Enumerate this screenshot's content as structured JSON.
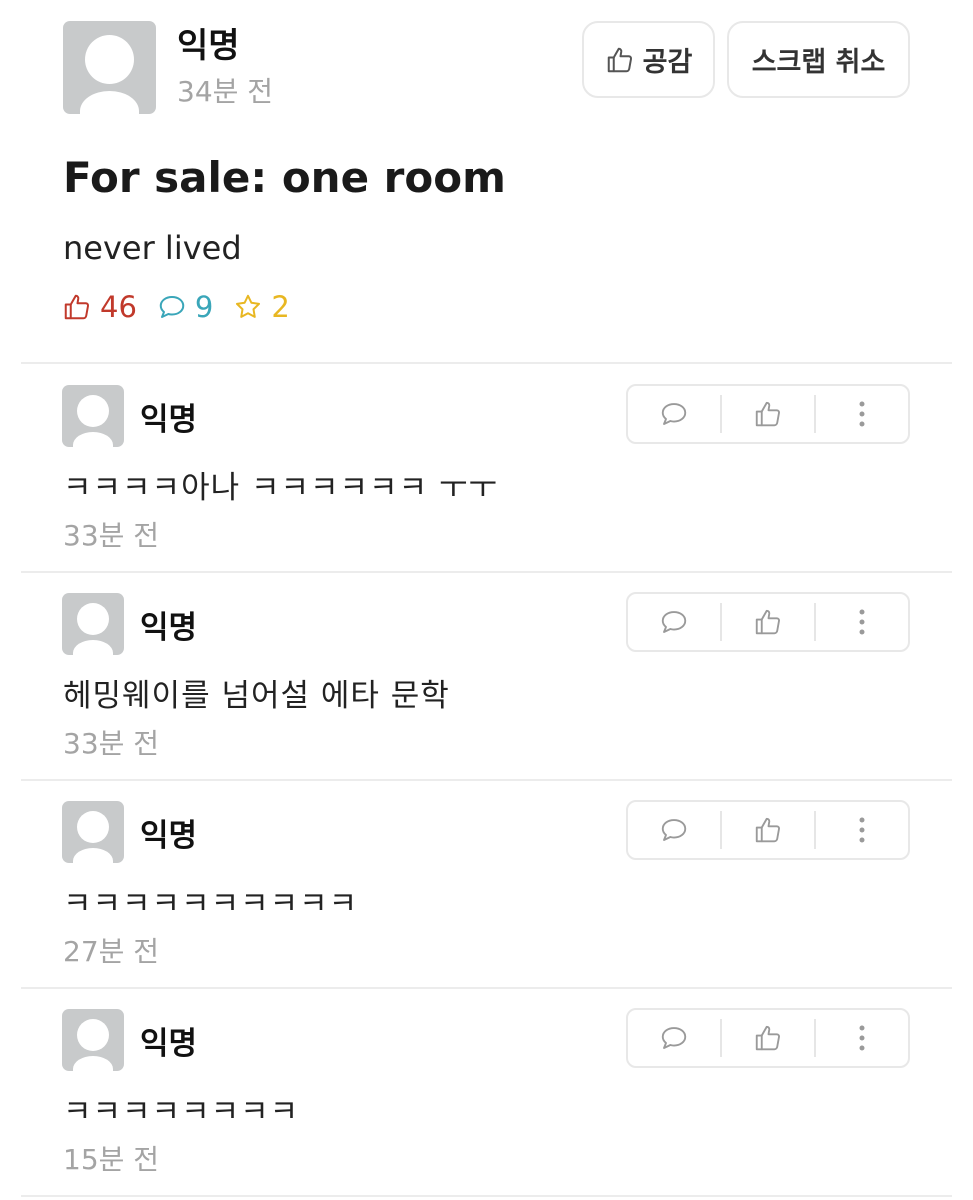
{
  "post": {
    "author": "익명",
    "time": "34분 전",
    "like_button_label": "공감",
    "scrap_cancel_label": "스크랩 취소",
    "title": "For sale: one room",
    "body": "never lived",
    "stats": {
      "likes": "46",
      "comments": "9",
      "scraps": "2"
    },
    "icons": {
      "like": "thumbs-up-icon",
      "comment": "speech-bubble-icon",
      "scrap": "star-icon"
    },
    "colors": {
      "like": "#c1392b",
      "comment": "#3aa6b9",
      "scrap": "#e8b722"
    }
  },
  "comments": [
    {
      "author": "익명",
      "text": "ㅋㅋㅋㅋ아나 ㅋㅋㅋㅋㅋㅋ ㅜㅜ",
      "time": "33분 전"
    },
    {
      "author": "익명",
      "text": "헤밍웨이를 넘어설 에타 문학",
      "time": "33분 전"
    },
    {
      "author": "익명",
      "text": "ㅋㅋㅋㅋㅋㅋㅋㅋㅋㅋ",
      "time": "27분 전"
    },
    {
      "author": "익명",
      "text": "ㅋㅋㅋㅋㅋㅋㅋㅋ",
      "time": "15분 전"
    }
  ],
  "comment_action_icons": [
    "reply-bubble-icon",
    "thumbs-up-icon",
    "more-vertical-icon"
  ]
}
